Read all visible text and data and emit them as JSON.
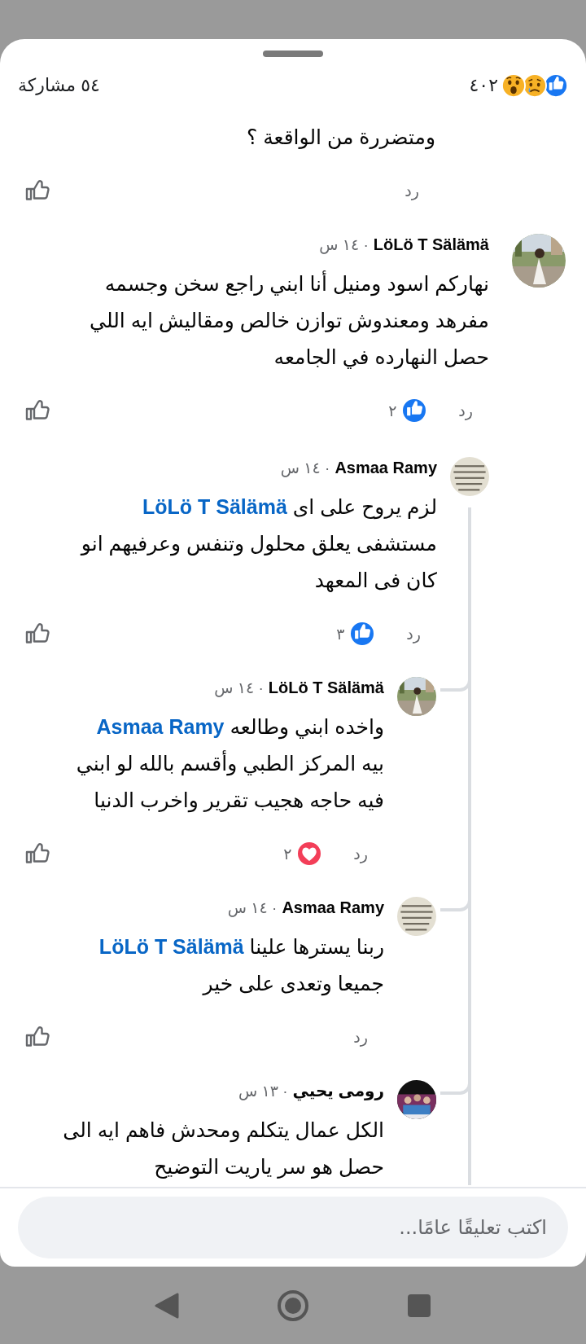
{
  "header": {
    "reactions": [
      {
        "kind": "like"
      },
      {
        "kind": "sad"
      },
      {
        "kind": "wow"
      }
    ],
    "reaction_count": "٤٠٢",
    "shares": "٥٤ مشاركة"
  },
  "comments": [
    {
      "kind": "reply-fragment",
      "text": [
        {
          "kind": "plain",
          "text": "ومتضررة من الواقعة ؟"
        }
      ],
      "reply": "رد"
    },
    {
      "kind": "comment",
      "author": "LöLö T Sälämä",
      "time": "· ١٤ س",
      "text": [
        {
          "kind": "plain",
          "text": "نهاركم اسود ومنيل أنا ابني راجع سخن وجسمه\nمفرهد ومعندوش توازن خالص ومقاليش ايه اللي\nحصل النهارده في الجامعه"
        }
      ],
      "reply": "رد",
      "reaction": {
        "kind": "like",
        "count": "٢"
      },
      "children": [
        {
          "kind": "comment",
          "author": "Asmaa Ramy",
          "time": "· ١٤ س",
          "text": [
            {
              "kind": "plain",
              "text": "لزم يروح على اى "
            },
            {
              "kind": "mention",
              "text": "LöLö T Sälämä"
            },
            {
              "kind": "plain",
              "text": "\nمستشفى يعلق محلول وتنفس وعرفيهم انو\nكان فى المعهد"
            }
          ],
          "reply": "رد",
          "reaction": {
            "kind": "like",
            "count": "٣"
          },
          "children": [
            {
              "kind": "comment",
              "author": "LöLö T Sälämä",
              "time": "· ١٤ س",
              "text": [
                {
                  "kind": "plain",
                  "text": "واخده ابني وطالعه "
                },
                {
                  "kind": "mention",
                  "text": "Asmaa Ramy"
                },
                {
                  "kind": "plain",
                  "text": "\nبيه المركز الطبي وأقسم بالله لو ابني\nفيه حاجه هجيب تقرير واخرب الدنيا"
                }
              ],
              "reply": "رد",
              "reaction": {
                "kind": "love",
                "count": "٢"
              }
            },
            {
              "kind": "comment",
              "author": "Asmaa Ramy",
              "time": "· ١٤ س",
              "text": [
                {
                  "kind": "plain",
                  "text": "ربنا يسترها علينا "
                },
                {
                  "kind": "mention",
                  "text": "LöLö T Sälämä"
                },
                {
                  "kind": "plain",
                  "text": "\nجميعا وتعدى على خير"
                }
              ],
              "reply": "رد"
            },
            {
              "kind": "comment",
              "author": "رومى يحيي",
              "time": "· ١٣ س",
              "text": [
                {
                  "kind": "plain",
                  "text": "الكل عمال يتكلم ومحدش فاهم ايه الى\nحصل هو سر ياريت التوضيح"
                }
              ]
            }
          ]
        }
      ]
    }
  ],
  "composer": {
    "placeholder": "اكتب تعليقًا عامًا..."
  }
}
